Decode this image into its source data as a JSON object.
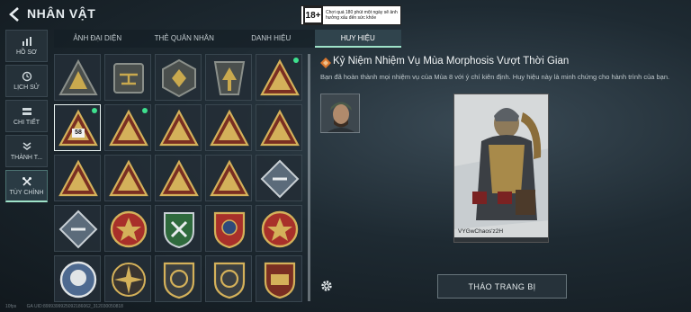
{
  "header": {
    "title": "NHÂN VẬT"
  },
  "age_rating": {
    "badge": "18+",
    "text": "Chơi quá 180 phút một ngày sẽ ảnh hưởng xấu đến sức khỏe"
  },
  "sidebar": {
    "items": [
      {
        "label": "HỒ SƠ",
        "icon": "bar-chart-icon"
      },
      {
        "label": "LỊCH SỬ",
        "icon": "history-icon"
      },
      {
        "label": "CHI TIẾT",
        "icon": "detail-icon"
      },
      {
        "label": "THÀNH T...",
        "icon": "achievement-icon"
      },
      {
        "label": "TÙY CHỈNH",
        "icon": "customize-icon"
      }
    ],
    "active_index": 4
  },
  "tabs": {
    "items": [
      "ẢNH ĐẠI DIỆN",
      "THẺ QUÂN NHÂN",
      "DANH HIỆU",
      "HUY HIỆU"
    ],
    "active_index": 3
  },
  "badges": {
    "selected_index": 5,
    "badge_number": "58",
    "items": [
      {
        "shape": "triangle-dark",
        "new": false
      },
      {
        "shape": "helicopter",
        "new": false
      },
      {
        "shape": "hex-dark",
        "new": false
      },
      {
        "shape": "arrow-dark",
        "new": false
      },
      {
        "shape": "triangle-gold",
        "new": true
      },
      {
        "shape": "triangle-gold",
        "new": true
      },
      {
        "shape": "triangle-gold",
        "new": true
      },
      {
        "shape": "triangle-gold",
        "new": false
      },
      {
        "shape": "triangle-gold",
        "new": false
      },
      {
        "shape": "triangle-gold",
        "new": false
      },
      {
        "shape": "triangle-gold",
        "new": false
      },
      {
        "shape": "triangle-gold",
        "new": false
      },
      {
        "shape": "triangle-gold",
        "new": false
      },
      {
        "shape": "triangle-gold",
        "new": false
      },
      {
        "shape": "diamond-blue",
        "new": false
      },
      {
        "shape": "diamond-blue",
        "new": false
      },
      {
        "shape": "round-red",
        "new": false
      },
      {
        "shape": "shield-green",
        "new": false
      },
      {
        "shape": "shield-blue",
        "new": false
      },
      {
        "shape": "round-red",
        "new": false
      },
      {
        "shape": "round-silver",
        "new": false
      },
      {
        "shape": "sun-gold",
        "new": false
      },
      {
        "shape": "shield-dark",
        "new": false
      },
      {
        "shape": "shield-dark",
        "new": false
      },
      {
        "shape": "shield-gold",
        "new": false
      }
    ]
  },
  "detail": {
    "title": "Kỷ Niệm Nhiệm Vụ Mùa Morphosis Vượt Thời Gian",
    "description": "Bạn đã hoàn thành mọi nhiệm vụ của Mùa 8 với ý chí kiên định. Huy hiệu này là minh chứng cho hành trình của bạn.",
    "player_name": "VYGwChaos'z2H",
    "remove_button": "THÁO TRANG BỊ"
  },
  "footer": {
    "fps": "10fps",
    "uid": "GA UID:8999399925092186062_312030050818"
  },
  "colors": {
    "accent": "#9fe3c9",
    "new_dot": "#3ee08e",
    "gold": "#c9a94e",
    "badge_dark": "#5a5f5d"
  }
}
